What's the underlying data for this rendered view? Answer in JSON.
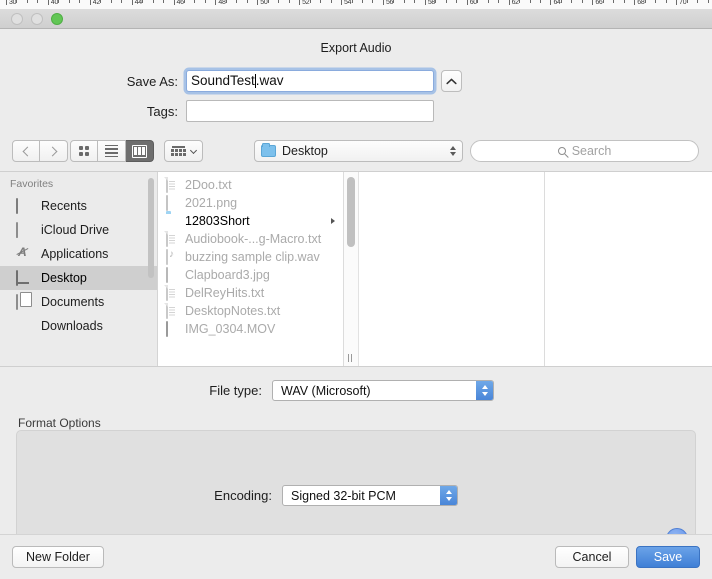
{
  "window": {
    "traffic_lights": [
      "close",
      "minimize",
      "zoom"
    ],
    "ruler_numbers": [
      "30",
      "40",
      "42",
      "44",
      "46",
      "48",
      "50",
      "52",
      "54",
      "56",
      "58",
      "60",
      "62",
      "64",
      "66",
      "68",
      "70"
    ]
  },
  "dialog": {
    "title": "Export Audio",
    "save_as_label": "Save As:",
    "save_as_value_before_caret": "SoundTest",
    "save_as_value_after_caret": ".wav",
    "save_as_full_value": "SoundTest.wav",
    "disclose_icon": "chevron-up-icon",
    "tags_label": "Tags:",
    "tags_value": "",
    "tags_placeholder": ""
  },
  "toolbar": {
    "back_icon": "chevron-left-icon",
    "forward_icon": "chevron-right-icon",
    "view_icon_label": "icon-view",
    "view_list_label": "list-view",
    "view_column_label": "column-view",
    "active_view": "column-view",
    "groupby_icon": "group-by-icon",
    "path_label": "Desktop",
    "path_icon": "folder-icon",
    "search_placeholder": "Search",
    "search_icon": "search-icon"
  },
  "sidebar": {
    "header": "Favorites",
    "selected": "Desktop",
    "items": [
      {
        "label": "Recents",
        "icon": "recents-icon"
      },
      {
        "label": "iCloud Drive",
        "icon": "cloud-icon"
      },
      {
        "label": "Applications",
        "icon": "applications-icon"
      },
      {
        "label": "Desktop",
        "icon": "desktop-icon"
      },
      {
        "label": "Documents",
        "icon": "documents-icon"
      },
      {
        "label": "Downloads",
        "icon": "downloads-icon"
      }
    ]
  },
  "files": {
    "items": [
      {
        "name": "2Doo.txt",
        "icon": "text-file-icon",
        "enabled": false,
        "folder": false
      },
      {
        "name": "2021.png",
        "icon": "image-file-icon",
        "enabled": false,
        "folder": false
      },
      {
        "name": "12803Short",
        "icon": "folder-icon",
        "enabled": true,
        "folder": true
      },
      {
        "name": "Audiobook-...g-Macro.txt",
        "icon": "text-file-icon",
        "enabled": false,
        "folder": false
      },
      {
        "name": "buzzing sample clip.wav",
        "icon": "audio-file-icon",
        "enabled": false,
        "folder": false
      },
      {
        "name": "Clapboard3.jpg",
        "icon": "jpg-file-icon",
        "enabled": false,
        "folder": false
      },
      {
        "name": "DelReyHits.txt",
        "icon": "text-file-icon",
        "enabled": false,
        "folder": false
      },
      {
        "name": "DesktopNotes.txt",
        "icon": "text-file-icon",
        "enabled": false,
        "folder": false
      },
      {
        "name": "IMG_0304.MOV",
        "icon": "movie-file-icon",
        "enabled": false,
        "folder": false
      }
    ]
  },
  "filetype": {
    "label": "File type:",
    "value": "WAV (Microsoft)"
  },
  "format_options": {
    "group_label": "Format Options",
    "encoding_label": "Encoding:",
    "encoding_value": "Signed 32-bit PCM"
  },
  "help": {
    "glyph": "?",
    "name": "help-button"
  },
  "buttons": {
    "new_folder": "New Folder",
    "cancel": "Cancel",
    "save": "Save"
  },
  "colors": {
    "accent": "#3f7fd6",
    "sheet_bg": "#ececec",
    "selection": "#cfcfcf",
    "folder_blue": "#7cc0ec",
    "green_light": "#62c655"
  }
}
